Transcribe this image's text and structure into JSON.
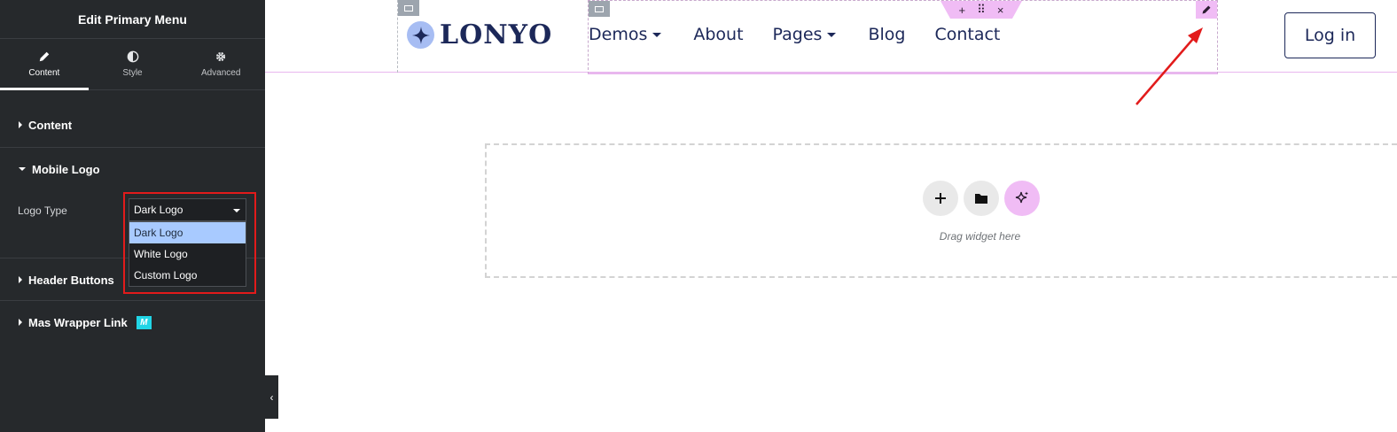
{
  "sidebar": {
    "title": "Edit Primary Menu",
    "tabs": [
      {
        "label": "Content",
        "icon": "pencil-icon"
      },
      {
        "label": "Style",
        "icon": "contrast-icon"
      },
      {
        "label": "Advanced",
        "icon": "gear-icon"
      }
    ],
    "sections": {
      "content": "Content",
      "mobile_logo": "Mobile Logo",
      "header_buttons": "Header Buttons",
      "mas_wrapper_link": "Mas Wrapper Link",
      "mas_badge": "M"
    },
    "logo_type": {
      "label": "Logo Type",
      "value": "Dark Logo",
      "options": [
        "Dark Logo",
        "White Logo",
        "Custom Logo"
      ]
    }
  },
  "canvas": {
    "logo_text": "LONYO",
    "nav": [
      "Demos",
      "About",
      "Pages",
      "Blog",
      "Contact"
    ],
    "login": "Log in",
    "toolbar": {
      "add": "+",
      "move": "⠿",
      "close": "×"
    },
    "dropzone_label": "Drag widget here"
  },
  "colors": {
    "sidebar_bg": "#26292c",
    "accent_pink": "#f0bcf5",
    "brand_navy": "#1c2859",
    "highlight_red": "#e21b1b",
    "selected_option": "#a8caff"
  }
}
